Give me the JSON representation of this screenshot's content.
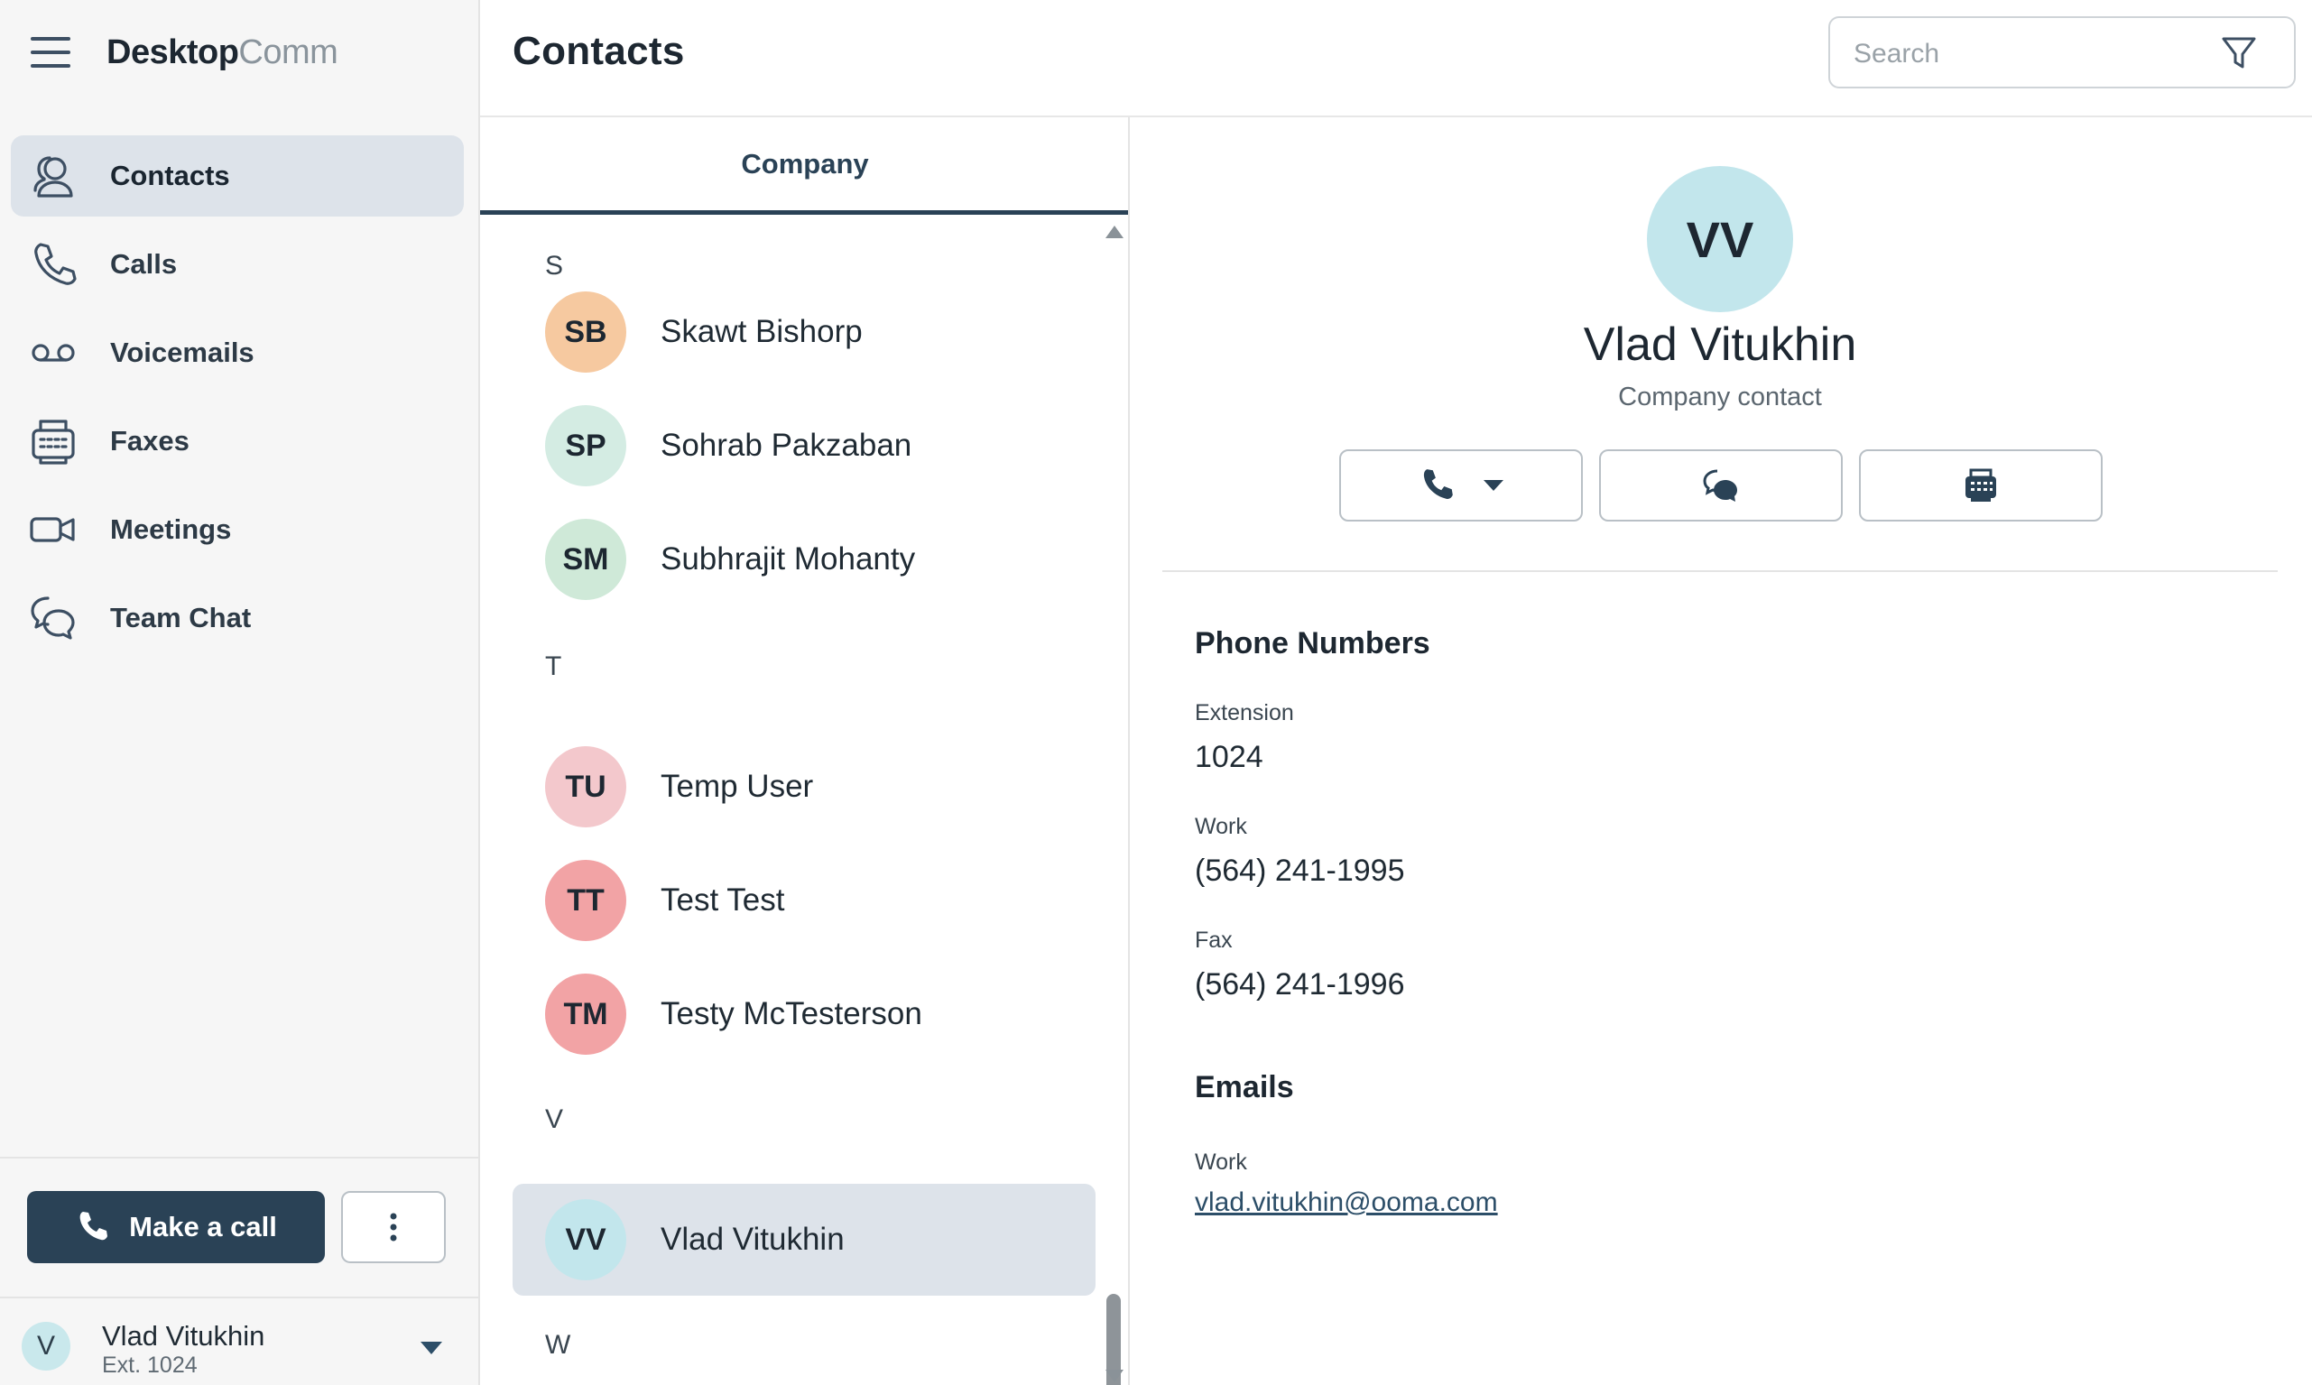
{
  "app": {
    "brand_part1": "Desktop",
    "brand_part2": "Comm"
  },
  "sidebar": {
    "items": [
      {
        "label": "Contacts",
        "icon": "contacts-icon",
        "active": true
      },
      {
        "label": "Calls",
        "icon": "phone-icon"
      },
      {
        "label": "Voicemails",
        "icon": "voicemail-icon"
      },
      {
        "label": "Faxes",
        "icon": "fax-icon"
      },
      {
        "label": "Meetings",
        "icon": "video-icon"
      },
      {
        "label": "Team Chat",
        "icon": "chat-icon"
      }
    ],
    "make_call_label": "Make a call",
    "user": {
      "initial": "V",
      "name": "Vlad Vitukhin",
      "ext": "Ext. 1024"
    }
  },
  "header": {
    "title": "Contacts",
    "search_placeholder": "Search"
  },
  "list": {
    "tab_label": "Company",
    "sections": [
      {
        "letter": "S"
      },
      {
        "letter": "T"
      },
      {
        "letter": "V"
      },
      {
        "letter": "W"
      }
    ],
    "contacts": [
      {
        "initials": "SB",
        "name": "Skawt Bishorp",
        "color": "#f6c9a0"
      },
      {
        "initials": "SP",
        "name": "Sohrab Pakzaban",
        "color": "#d4ece3"
      },
      {
        "initials": "SM",
        "name": "Subhrajit Mohanty",
        "color": "#cfe9d8"
      },
      {
        "initials": "TU",
        "name": "Temp User",
        "color": "#f3c8cc"
      },
      {
        "initials": "TT",
        "name": "Test Test",
        "color": "#f2a3a5"
      },
      {
        "initials": "TM",
        "name": "Testy McTesterson",
        "color": "#f2a3a5"
      },
      {
        "initials": "VV",
        "name": "Vlad Vitukhin",
        "color": "#c2e6ec",
        "selected": true
      }
    ]
  },
  "detail": {
    "initials": "VV",
    "name": "Vlad Vitukhin",
    "subtitle": "Company contact",
    "phone_numbers_heading": "Phone Numbers",
    "phones": [
      {
        "label": "Extension",
        "value": "1024"
      },
      {
        "label": "Work",
        "value": "(564) 241-1995"
      },
      {
        "label": "Fax",
        "value": "(564) 241-1996"
      }
    ],
    "emails_heading": "Emails",
    "emails": [
      {
        "label": "Work",
        "value": "vlad.vitukhin@ooma.com"
      }
    ]
  },
  "colors": {
    "accent": "#2a4256",
    "selected_bg": "#dde3ea",
    "sidebar_bg": "#f6f6f6"
  }
}
